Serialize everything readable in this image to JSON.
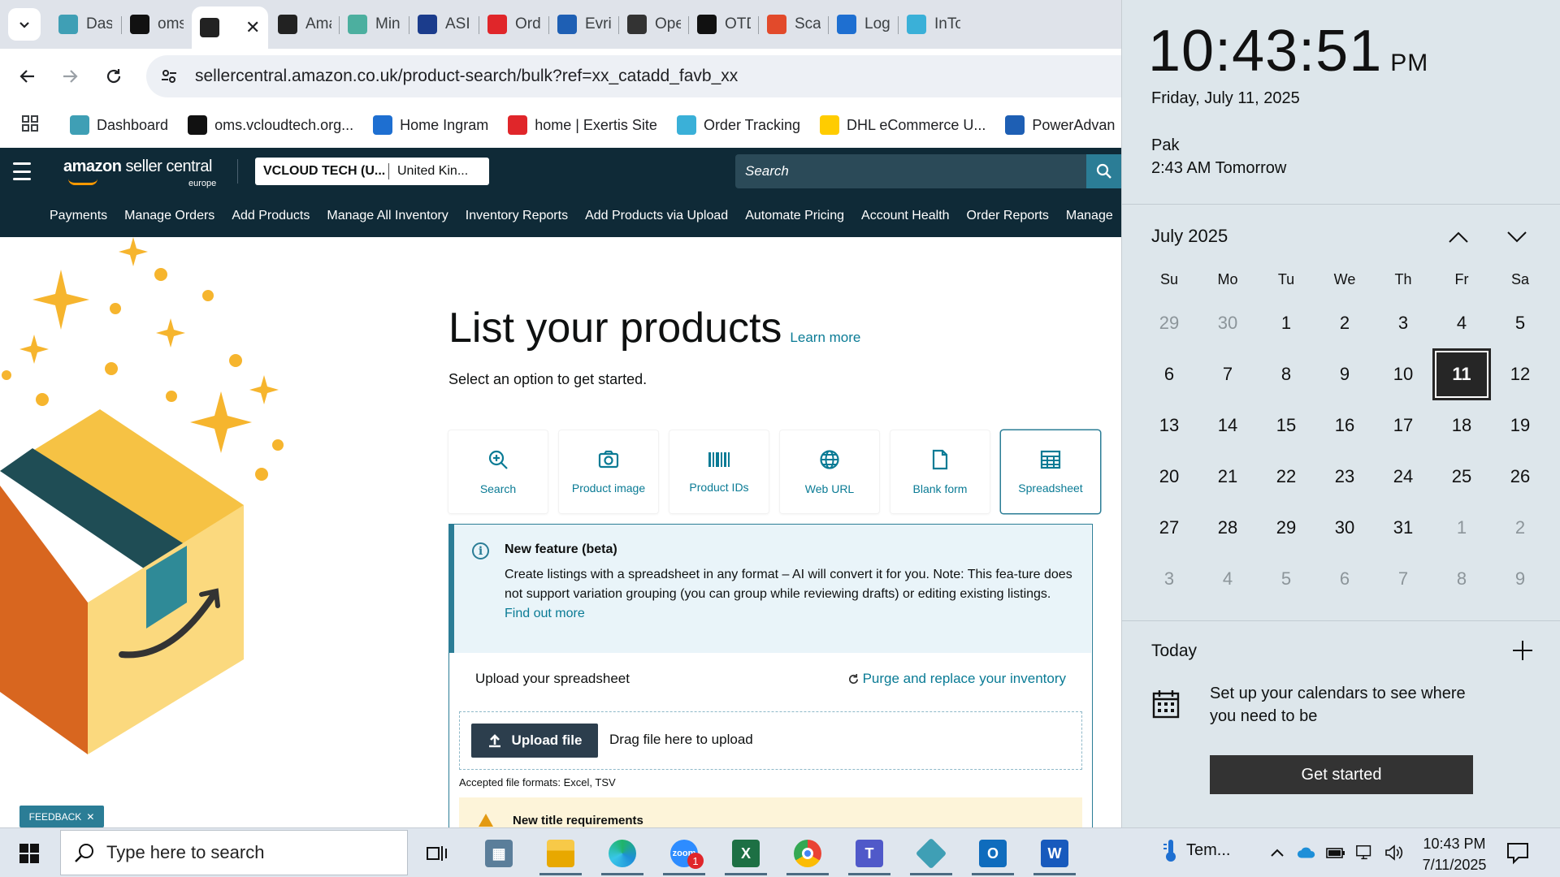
{
  "browser": {
    "tabs": [
      {
        "title": "Das",
        "icon": "dashboard-icon",
        "color": "#3f9fb5"
      },
      {
        "title": "oms",
        "icon": "oms-icon",
        "color": "#111111"
      },
      {
        "title": "",
        "icon": "amazon-icon",
        "color": "#222222",
        "active": true
      },
      {
        "title": "Ama",
        "icon": "amazon-icon",
        "color": "#222222"
      },
      {
        "title": "Min",
        "icon": "min-icon",
        "color": "#4caf9f"
      },
      {
        "title": "ASI",
        "icon": "asi-icon",
        "color": "#1b3c8c"
      },
      {
        "title": "Ord",
        "icon": "exertis-icon",
        "color": "#e0262a"
      },
      {
        "title": "Evri",
        "icon": "evri-icon",
        "color": "#1e5fb4"
      },
      {
        "title": "Ope",
        "icon": "openai-icon",
        "color": "#333333"
      },
      {
        "title": "OTD",
        "icon": "openai-icon",
        "color": "#111111"
      },
      {
        "title": "Scar",
        "icon": "scan-icon",
        "color": "#e24a2b"
      },
      {
        "title": "Log",
        "icon": "log-icon",
        "color": "#1e6fd1"
      },
      {
        "title": "InTo",
        "icon": "into-icon",
        "color": "#3ab0d8"
      }
    ],
    "url": "sellercentral.amazon.co.uk/product-search/bulk?ref=xx_catadd_favb_xx",
    "bookmarks": [
      {
        "label": "Dashboard",
        "color": "#3f9fb5"
      },
      {
        "label": "oms.vcloudtech.org...",
        "color": "#111111"
      },
      {
        "label": "Home Ingram",
        "color": "#1e6fd1"
      },
      {
        "label": "home | Exertis Site",
        "color": "#e0262a"
      },
      {
        "label": "Order Tracking",
        "color": "#3ab0d8"
      },
      {
        "label": "DHL eCommerce U...",
        "color": "#ffcc00"
      },
      {
        "label": "PowerAdvan",
        "color": "#1e5fb4"
      }
    ]
  },
  "seller": {
    "logo_main": "amazon",
    "logo_sub": "seller central",
    "logo_region": "europe",
    "account_name": "VCLOUD TECH (U...",
    "account_region": "United Kin...",
    "search_placeholder": "Search",
    "nav": [
      "Payments",
      "Manage Orders",
      "Add Products",
      "Manage All Inventory",
      "Inventory Reports",
      "Add Products via Upload",
      "Automate Pricing",
      "Account Health",
      "Order Reports",
      "Manage"
    ]
  },
  "page": {
    "title": "List your products",
    "learn_more": "Learn more",
    "subtitle": "Select an option to get started.",
    "options": [
      {
        "label": "Search",
        "icon": "search-zoom-icon"
      },
      {
        "label": "Product image",
        "icon": "camera-icon"
      },
      {
        "label": "Product IDs",
        "icon": "barcode-icon"
      },
      {
        "label": "Web URL",
        "icon": "globe-icon"
      },
      {
        "label": "Blank form",
        "icon": "document-icon"
      },
      {
        "label": "Spreadsheet",
        "icon": "spreadsheet-icon",
        "selected": true
      }
    ],
    "feature_title": "New feature (beta)",
    "feature_body": "Create listings with a spreadsheet in any format – AI will convert it for you. Note: This fea-ture does not support variation grouping (you can group while reviewing drafts) or editing existing listings.",
    "feature_link": "Find out more",
    "upload_label": "Upload your spreadsheet",
    "purge_link": "Purge and replace your inventory",
    "upload_button": "Upload file",
    "drag_text": "Drag file here to upload",
    "accepted": "Accepted file formats: Excel, TSV",
    "warning_title": "New title requirements",
    "feedback": "FEEDBACK"
  },
  "flyout": {
    "time": "10:43:51",
    "ampm": "PM",
    "date": "Friday, July 11, 2025",
    "tz_name": "Pak",
    "tz_time": "2:43 AM Tomorrow",
    "month": "July 2025",
    "weekdays": [
      "Su",
      "Mo",
      "Tu",
      "We",
      "Th",
      "Fr",
      "Sa"
    ],
    "days": [
      {
        "n": "29",
        "other": true
      },
      {
        "n": "30",
        "other": true
      },
      {
        "n": "1"
      },
      {
        "n": "2"
      },
      {
        "n": "3"
      },
      {
        "n": "4"
      },
      {
        "n": "5"
      },
      {
        "n": "6"
      },
      {
        "n": "7"
      },
      {
        "n": "8"
      },
      {
        "n": "9"
      },
      {
        "n": "10"
      },
      {
        "n": "11",
        "today": true
      },
      {
        "n": "12"
      },
      {
        "n": "13"
      },
      {
        "n": "14"
      },
      {
        "n": "15"
      },
      {
        "n": "16"
      },
      {
        "n": "17"
      },
      {
        "n": "18"
      },
      {
        "n": "19"
      },
      {
        "n": "20"
      },
      {
        "n": "21"
      },
      {
        "n": "22"
      },
      {
        "n": "23"
      },
      {
        "n": "24"
      },
      {
        "n": "25"
      },
      {
        "n": "26"
      },
      {
        "n": "27"
      },
      {
        "n": "28"
      },
      {
        "n": "29"
      },
      {
        "n": "30"
      },
      {
        "n": "31"
      },
      {
        "n": "1",
        "other": true
      },
      {
        "n": "2",
        "other": true
      },
      {
        "n": "3",
        "other": true
      },
      {
        "n": "4",
        "other": true
      },
      {
        "n": "5",
        "other": true
      },
      {
        "n": "6",
        "other": true
      },
      {
        "n": "7",
        "other": true
      },
      {
        "n": "8",
        "other": true
      },
      {
        "n": "9",
        "other": true
      }
    ],
    "today_label": "Today",
    "setup_text": "Set up your calendars to see where you need to be",
    "get_started": "Get started"
  },
  "taskbar": {
    "search_placeholder": "Type here to search",
    "weather": "Tem...",
    "time": "10:43 PM",
    "date": "7/11/2025",
    "zoom_badge": "1",
    "apps": [
      "task-view-icon",
      "calculator-icon",
      "file-explorer-icon",
      "edge-icon",
      "zoom-icon",
      "excel-icon",
      "chrome-icon",
      "teams-icon",
      "app-icon",
      "outlook-icon",
      "word-icon"
    ]
  }
}
